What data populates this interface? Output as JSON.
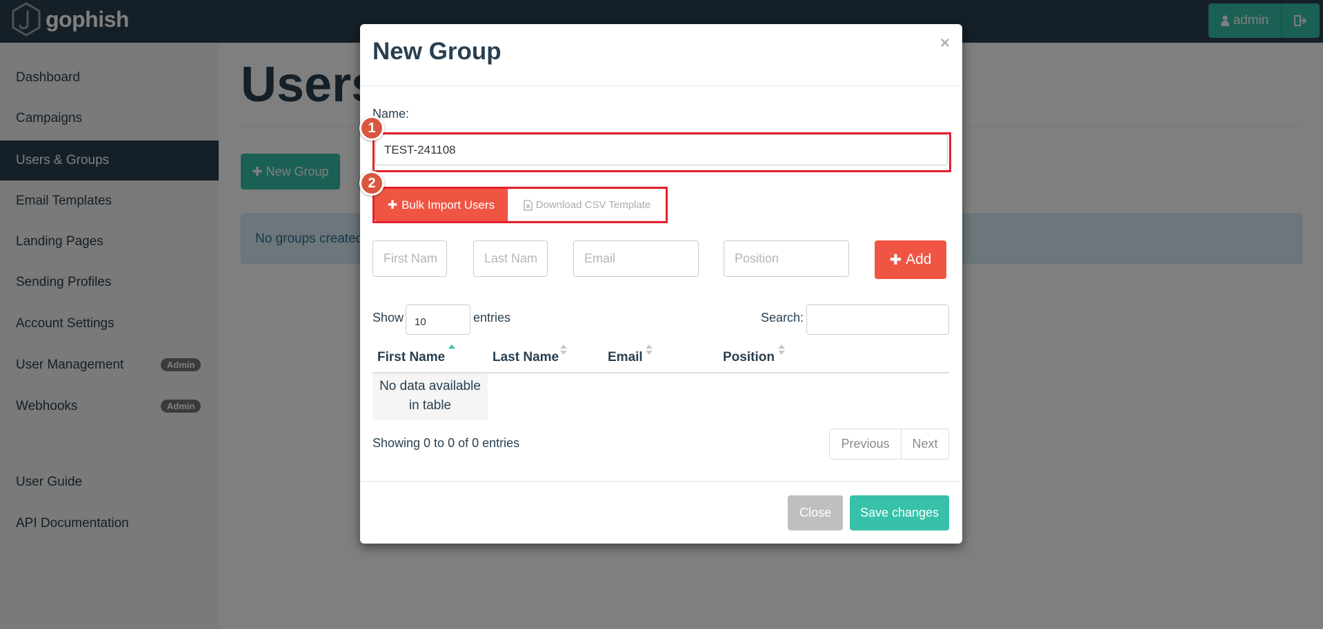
{
  "navbar": {
    "brand": "gophish",
    "user_label": "admin",
    "icons": {
      "brand": "gophish-hook-logo",
      "user": "user-icon",
      "logout": "logout-icon"
    }
  },
  "sidebar": {
    "items": [
      {
        "label": "Dashboard"
      },
      {
        "label": "Campaigns"
      },
      {
        "label": "Users & Groups",
        "active": true
      },
      {
        "label": "Email Templates"
      },
      {
        "label": "Landing Pages"
      },
      {
        "label": "Sending Profiles"
      },
      {
        "label": "Account Settings"
      },
      {
        "label": "User Management",
        "badge": "Admin"
      },
      {
        "label": "Webhooks",
        "badge": "Admin"
      }
    ],
    "help_items": [
      {
        "label": "User Guide"
      },
      {
        "label": "API Documentation"
      }
    ]
  },
  "main": {
    "title": "Users",
    "new_group_button": "New Group",
    "alert_text": "No groups created"
  },
  "modal": {
    "title": "New Group",
    "close_symbol": "×",
    "name_label": "Name:",
    "name_value": "TEST-241108",
    "markers": [
      "1",
      "2"
    ],
    "bulk_import_label": "Bulk Import Users",
    "csv_template_label": "Download CSV Template",
    "fields": {
      "first_name_placeholder": "First Nam",
      "last_name_placeholder": "Last Nam",
      "email_placeholder": "Email",
      "position_placeholder": "Position"
    },
    "add_label": "Add",
    "show_label": "Show",
    "entries_value": "10",
    "entries_label": "entries",
    "search_label": "Search:",
    "columns": [
      "First Name",
      "Last Name",
      "Email",
      "Position"
    ],
    "no_data_line1": "No data available",
    "no_data_line2": "in table",
    "showing_text": "Showing 0 to 0 of 0 entries",
    "prev_label": "Previous",
    "next_label": "Next",
    "close_label": "Close",
    "save_label": "Save changes"
  },
  "colors": {
    "navbar": "#283f50",
    "accent_teal": "#37c1a8",
    "danger": "#f05543",
    "highlight_red": "#e3202b",
    "marker": "#d9573f"
  }
}
